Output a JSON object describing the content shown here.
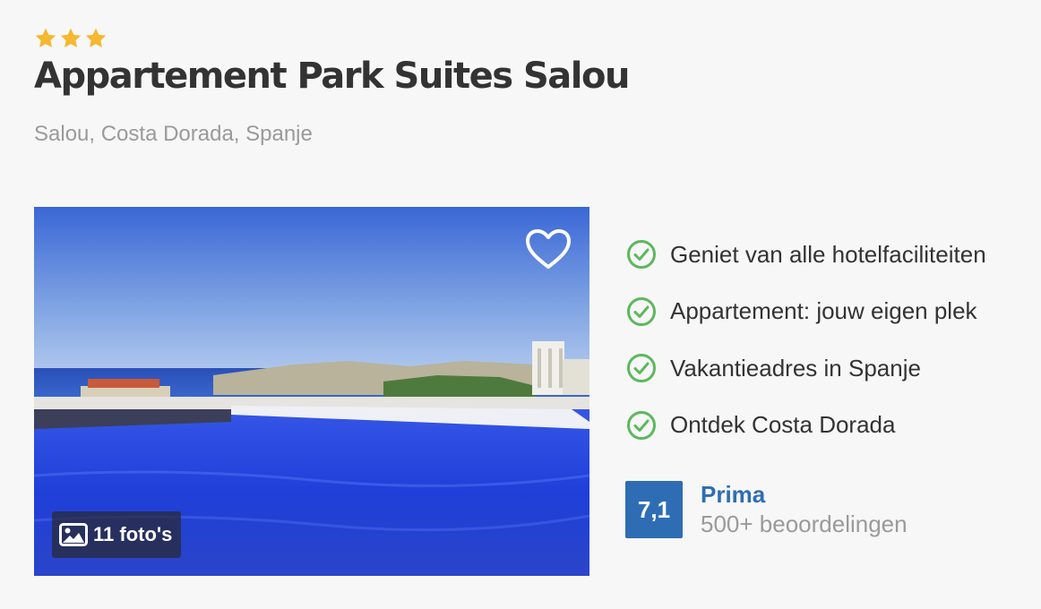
{
  "hotel": {
    "stars": 3,
    "star_color": "#f5b82e",
    "name": "Appartement Park Suites Salou",
    "location": "Salou, Costa Dorada, Spanje"
  },
  "gallery": {
    "favorite_icon": "heart-outline-icon",
    "photo_icon": "image-icon",
    "photo_count_label": "11 foto's"
  },
  "features": {
    "check_icon": "check-circle-icon",
    "check_color": "#5cb85c",
    "items": [
      "Geniet van alle hotelfaciliteiten",
      "Appartement: jouw eigen plek",
      "Vakantieadres in Spanje",
      "Ontdek Costa Dorada"
    ]
  },
  "rating": {
    "score": "7,1",
    "label": "Prima",
    "count_label": "500+ beoordelingen",
    "accent_color": "#2e6db4"
  }
}
